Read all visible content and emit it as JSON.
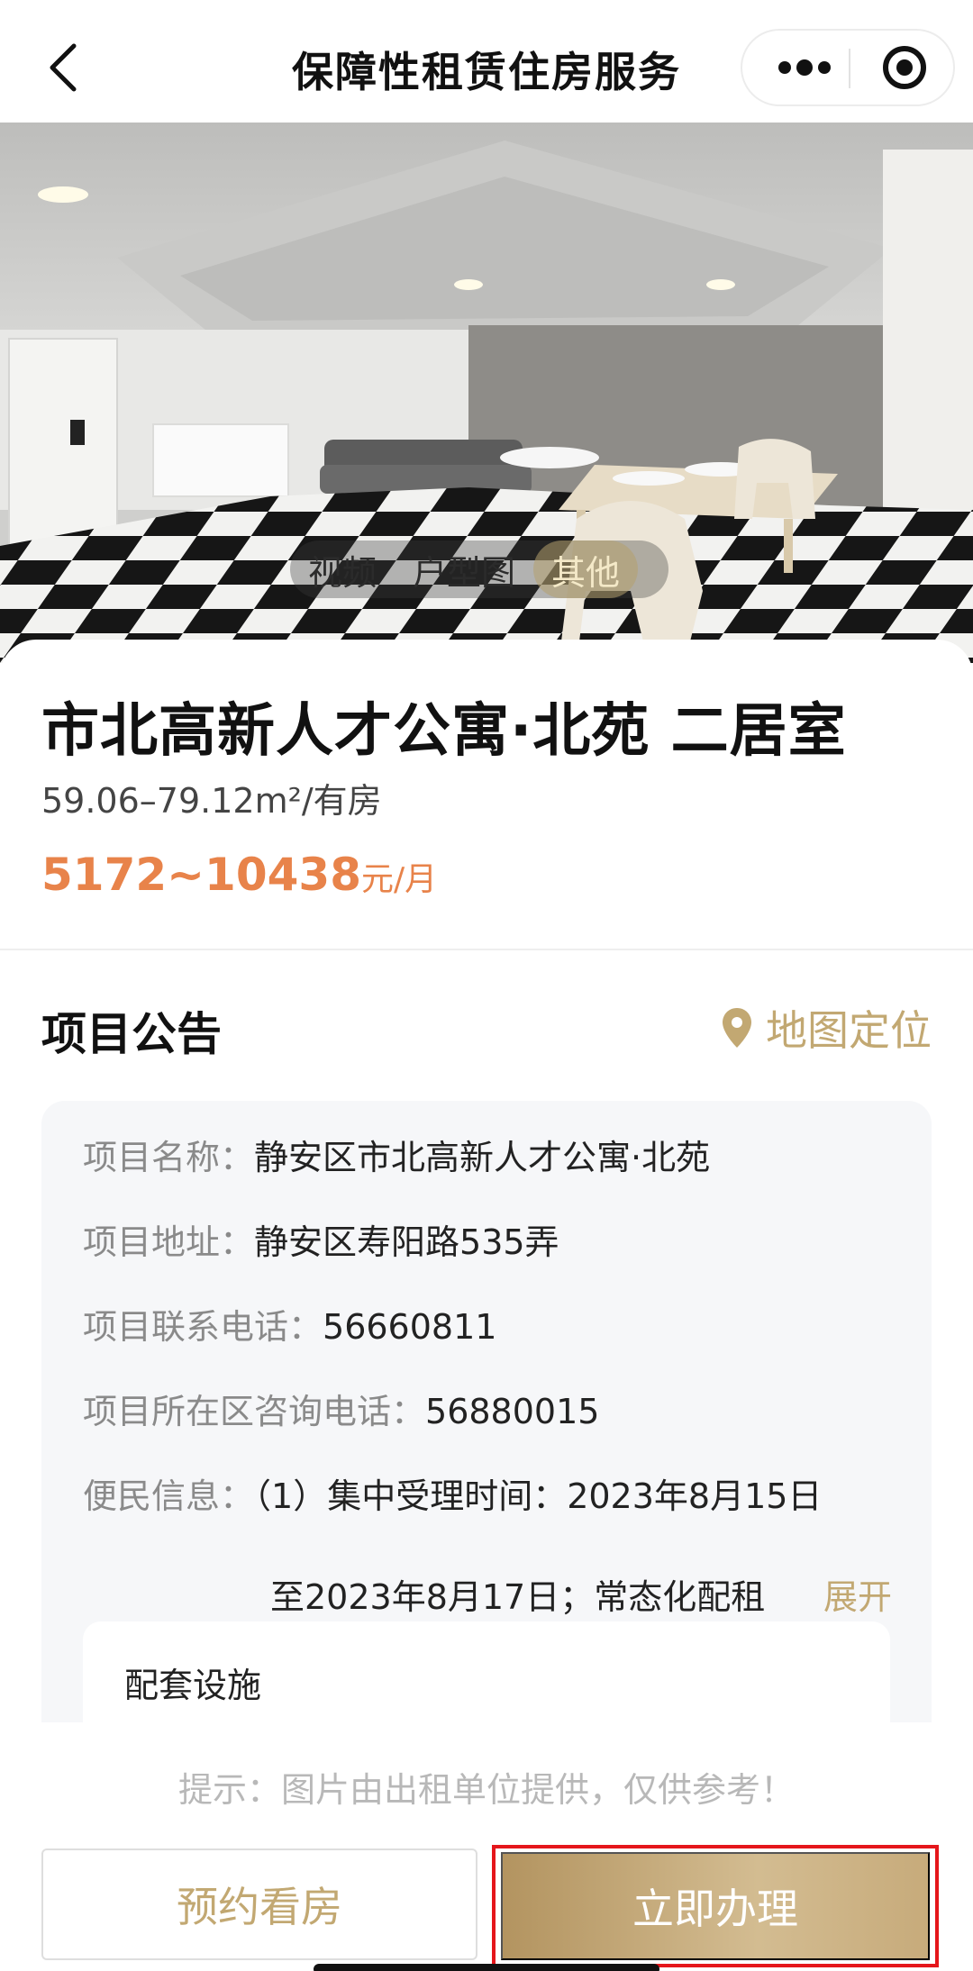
{
  "navbar": {
    "title": "保障性租赁住房服务",
    "back_icon": "chevron-left-icon",
    "more_icon": "more-dots-icon",
    "target_icon": "target-circle-icon"
  },
  "media_tabs": {
    "items": [
      "视频",
      "户型图",
      "其他"
    ],
    "active": "其他"
  },
  "listing": {
    "title": "市北高新人才公寓·北苑 二居室",
    "area": "59.06–79.12m²/有房",
    "price": "5172~10438",
    "price_unit": "元/月",
    "price_color": "#e8834a"
  },
  "announcement": {
    "heading": "项目公告",
    "map_link": "地图定位",
    "map_icon": "location-pin-icon",
    "rows": [
      {
        "label": "项目名称：",
        "value": "静安区市北高新人才公寓·北苑"
      },
      {
        "label": "项目地址：",
        "value": "静安区寿阳路535弄"
      },
      {
        "label": "项目联系电话：",
        "value": "56660811"
      },
      {
        "label": "项目所在区咨询电话：",
        "value": "56880015"
      },
      {
        "label": "便民信息：",
        "value": "（1）集中受理时间：2023年8月15日"
      }
    ],
    "notice_line2": "至2023年8月17日；常态化配租",
    "expand": "展开",
    "facility_label": "配套设施"
  },
  "bottom": {
    "tip": "提示：图片由出租单位提供，仅供参考！",
    "appointment_button": "预约看房",
    "apply_button": "立即办理",
    "accent_color": "#c2a872"
  }
}
